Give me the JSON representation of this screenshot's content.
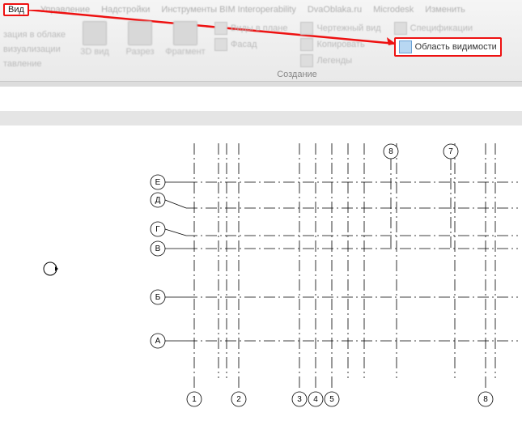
{
  "tabs": {
    "active": "Вид",
    "others": [
      "Управление",
      "Надстройки",
      "Инструменты BIM Interoperability",
      "DvaOblaka.ru",
      "Microdesk",
      "Изменить"
    ]
  },
  "leftPanel": {
    "l1": "зация в облаке",
    "l2": "визуализации",
    "l3": "тавление"
  },
  "bigTools": {
    "t1": "3D вид",
    "t2": "Разрез",
    "t3": "Фрагмент"
  },
  "col1": {
    "a": "Виды в плане",
    "b": "Фасад"
  },
  "col2": {
    "a": "Чертежный вид",
    "b": "Копировать",
    "c": "Легенды"
  },
  "col3": {
    "a": "Спецификации",
    "b": "Область видимости"
  },
  "panelLabel": "Создание",
  "gridLetters": [
    "Е",
    "Д",
    "Г",
    "В",
    "Б",
    "А"
  ],
  "gridNumbers": [
    "1",
    "2",
    "3",
    "4",
    "5",
    "8"
  ],
  "gridTop": [
    "8",
    "7"
  ]
}
